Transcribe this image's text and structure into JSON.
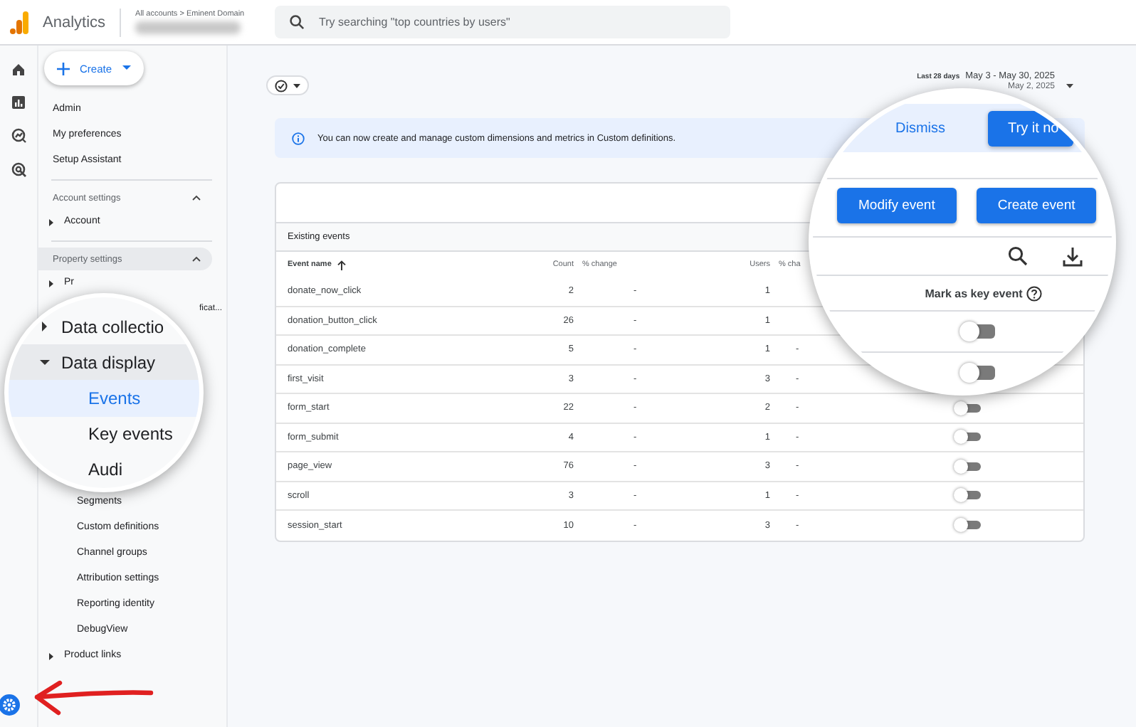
{
  "topbar": {
    "app_name": "Analytics",
    "breadcrumb": "All accounts > Eminent Domain",
    "search": {
      "placeholder": "Try searching \"top countries by users\""
    }
  },
  "sidebar": {
    "create_label": "Create",
    "top_items": [
      "Admin",
      "My preferences",
      "Setup Assistant"
    ],
    "sections": [
      {
        "title": "Account settings",
        "expanded": true,
        "highlighted": false,
        "items": [
          {
            "label": "Account",
            "expanded": false
          }
        ]
      },
      {
        "title": "Property settings",
        "expanded": true,
        "highlighted": true,
        "items": [
          {
            "label": "Pr",
            "expanded": false
          }
        ]
      }
    ],
    "side_fragment": "ficat...",
    "children": [
      "Segments",
      "Custom definitions",
      "Channel groups",
      "Attribution settings",
      "Reporting identity",
      "DebugView"
    ],
    "bottom_items": [
      {
        "label": "Product links",
        "expanded": false
      }
    ]
  },
  "magnifier_left": {
    "items": [
      {
        "label": "Data collectio",
        "kind": "group",
        "expanded": false
      },
      {
        "label": "Data display",
        "kind": "group",
        "expanded": true
      },
      {
        "label": "Events",
        "kind": "child",
        "selected": true
      },
      {
        "label": "Key events",
        "kind": "child",
        "selected": false
      },
      {
        "label": "Audi",
        "kind": "child",
        "selected": false
      }
    ]
  },
  "date": {
    "preset": "Last 28 days",
    "range": "May 3 - May 30, 2025",
    "compare": "May 2, 2025"
  },
  "banner": {
    "text": "You can now create and manage custom dimensions and metrics in Custom definitions.",
    "dismiss": "Dismiss",
    "action": "Try it no"
  },
  "magnifier_right": {
    "buttons": [
      "Modify event",
      "Create event"
    ],
    "key_event_header": "Mark as key event",
    "toggles": [
      {
        "on": false
      },
      {
        "on": false
      }
    ]
  },
  "table": {
    "title": "Existing events",
    "columns": [
      "Event name",
      "Count",
      "% change",
      "Users",
      "% cha"
    ],
    "rows": [
      {
        "name": "donate_now_click",
        "count": "2",
        "count_change": "-",
        "users": "1"
      },
      {
        "name": "donation_button_click",
        "count": "26",
        "count_change": "-",
        "users": "1"
      },
      {
        "name": "donation_complete",
        "count": "5",
        "count_change": "-",
        "users": "1",
        "users_change": "-"
      },
      {
        "name": "first_visit",
        "count": "3",
        "count_change": "-",
        "users": "3",
        "users_change": "-"
      },
      {
        "name": "form_start",
        "count": "22",
        "count_change": "-",
        "users": "2",
        "users_change": "-",
        "key_event": false
      },
      {
        "name": "form_submit",
        "count": "4",
        "count_change": "-",
        "users": "1",
        "users_change": "-",
        "key_event": false
      },
      {
        "name": "page_view",
        "count": "76",
        "count_change": "-",
        "users": "3",
        "users_change": "-",
        "key_event": false
      },
      {
        "name": "scroll",
        "count": "3",
        "count_change": "-",
        "users": "1",
        "users_change": "-",
        "key_event": false
      },
      {
        "name": "session_start",
        "count": "10",
        "count_change": "-",
        "users": "3",
        "users_change": "-",
        "key_event": false
      }
    ]
  }
}
